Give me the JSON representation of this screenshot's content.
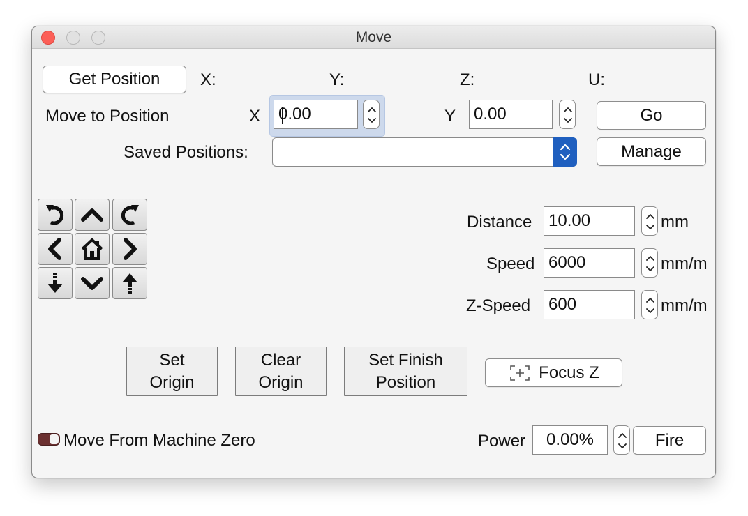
{
  "window": {
    "title": "Move"
  },
  "position": {
    "get_button": "Get Position",
    "x_label": "X:",
    "y_label": "Y:",
    "z_label": "Z:",
    "u_label": "U:"
  },
  "move_to": {
    "label": "Move to Position",
    "x_label": "X",
    "x_value": "0.00",
    "y_label": "Y",
    "y_value": "0.00",
    "go_button": "Go"
  },
  "saved": {
    "label": "Saved Positions:",
    "selected": "",
    "manage_button": "Manage"
  },
  "jog_icons": [
    "rotate-ccw-icon",
    "arrow-up-icon",
    "rotate-cw-icon",
    "arrow-left-icon",
    "home-icon",
    "arrow-right-icon",
    "z-down-icon",
    "arrow-down-icon",
    "z-up-icon"
  ],
  "settings": {
    "distance_label": "Distance",
    "distance_value": "10.00",
    "distance_unit": "mm",
    "speed_label": "Speed",
    "speed_value": "6000",
    "speed_unit": "mm/m",
    "zspeed_label": "Z-Speed",
    "zspeed_value": "600",
    "zspeed_unit": "mm/m"
  },
  "actions": {
    "set_origin_line1": "Set",
    "set_origin_line2": "Origin",
    "clear_origin_line1": "Clear",
    "clear_origin_line2": "Origin",
    "set_finish_line1": "Set Finish",
    "set_finish_line2": "Position",
    "focus_z": "Focus Z"
  },
  "footer": {
    "machine_zero_label": "Move From Machine Zero",
    "machine_zero_on": true,
    "power_label": "Power",
    "power_value": "0.00%",
    "fire_button": "Fire"
  },
  "colors": {
    "accent": "#1f5fbf",
    "close": "#fc5f57",
    "toggle": "#6b3030"
  }
}
